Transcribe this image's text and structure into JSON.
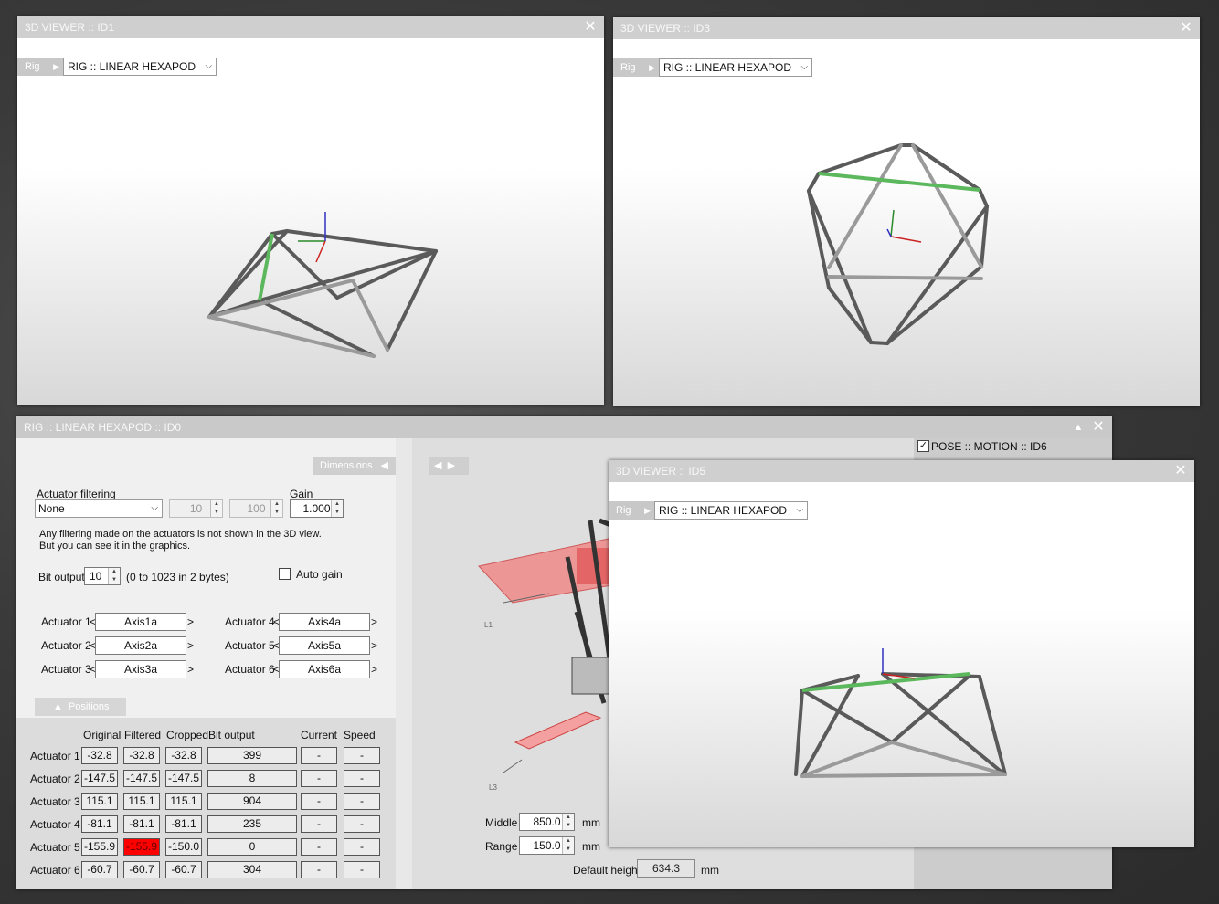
{
  "viewers": {
    "id1": {
      "title": "3D VIEWER :: ID1",
      "rig_tab": "Rig",
      "rig_select": "RIG :: LINEAR HEXAPOD"
    },
    "id3": {
      "title": "3D VIEWER :: ID3",
      "rig_tab": "Rig",
      "rig_select": "RIG :: LINEAR HEXAPOD"
    },
    "id5": {
      "title": "3D VIEWER :: ID5",
      "rig_tab": "Rig",
      "rig_select": "RIG :: LINEAR HEXAPOD"
    }
  },
  "close_glyph": "✕",
  "main": {
    "title": "RIG :: LINEAR HEXAPOD :: ID0",
    "pose_label": "POSE :: MOTION :: ID6",
    "pose_checked": "✓",
    "dimensions_tab": "Dimensions",
    "filtering": {
      "label": "Actuator filtering",
      "select": "None",
      "val1": "10",
      "val2": "100",
      "gain_label": "Gain",
      "gain": "1.000",
      "note1": "Any filtering made on the actuators is not shown in the 3D view.",
      "note2": "But you can see it in the graphics."
    },
    "bit_output": {
      "label": "Bit output",
      "value": "10",
      "hint": "(0 to 1023 in 2 bytes)"
    },
    "auto_gain": "Auto gain",
    "actuators": [
      {
        "label": "Actuator 1",
        "axis": "Axis1a"
      },
      {
        "label": "Actuator 2",
        "axis": "Axis2a"
      },
      {
        "label": "Actuator 3",
        "axis": "Axis3a"
      },
      {
        "label": "Actuator 4",
        "axis": "Axis4a"
      },
      {
        "label": "Actuator 5",
        "axis": "Axis5a"
      },
      {
        "label": "Actuator 6",
        "axis": "Axis6a"
      }
    ],
    "lt": "<",
    "gt": ">",
    "positions_tab": "Positions",
    "columns": [
      "Original",
      "Filtered",
      "Cropped",
      "Bit output",
      "Current",
      "Speed"
    ],
    "rows": [
      {
        "label": "Actuator 1",
        "original": "-32.8",
        "filtered": "-32.8",
        "cropped": "-32.8",
        "bit": "399",
        "current": "-",
        "speed": "-"
      },
      {
        "label": "Actuator 2",
        "original": "-147.5",
        "filtered": "-147.5",
        "cropped": "-147.5",
        "bit": "8",
        "current": "-",
        "speed": "-"
      },
      {
        "label": "Actuator 3",
        "original": "115.1",
        "filtered": "115.1",
        "cropped": "115.1",
        "bit": "904",
        "current": "-",
        "speed": "-"
      },
      {
        "label": "Actuator 4",
        "original": "-81.1",
        "filtered": "-81.1",
        "cropped": "-81.1",
        "bit": "235",
        "current": "-",
        "speed": "-"
      },
      {
        "label": "Actuator 5",
        "original": "-155.9",
        "filtered": "-155.9",
        "cropped": "-150.0",
        "bit": "0",
        "current": "-",
        "speed": "-"
      },
      {
        "label": "Actuator 6",
        "original": "-60.7",
        "filtered": "-60.7",
        "cropped": "-60.7",
        "bit": "304",
        "current": "-",
        "speed": "-"
      }
    ],
    "render_labels": {
      "l1": "L1",
      "l3": "L3"
    },
    "middle": {
      "label": "Middle",
      "value": "850.0",
      "unit": "mm"
    },
    "range": {
      "label": "Range",
      "value": "150.0",
      "unit": "mm"
    },
    "default_height": {
      "label": "Default height",
      "value": "634.3",
      "unit": "mm"
    }
  },
  "colors": {
    "titlebar": "#cfcfcf",
    "highlight_edge": "#4caf50",
    "alert": "#ff0000"
  }
}
